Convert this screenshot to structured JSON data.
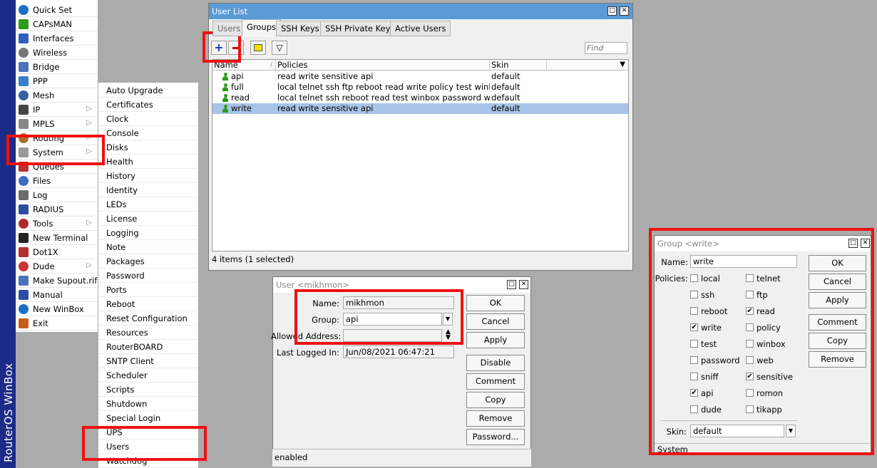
{
  "brand": "RouterOS WinBox",
  "main_menu": [
    {
      "label": "Quick Set",
      "icon": "quickset-icon",
      "arrow": false
    },
    {
      "label": "CAPsMAN",
      "icon": "capsman-icon",
      "arrow": false
    },
    {
      "label": "Interfaces",
      "icon": "interfaces-icon",
      "arrow": false
    },
    {
      "label": "Wireless",
      "icon": "wireless-icon",
      "arrow": false
    },
    {
      "label": "Bridge",
      "icon": "bridge-icon",
      "arrow": false
    },
    {
      "label": "PPP",
      "icon": "ppp-icon",
      "arrow": false
    },
    {
      "label": "Mesh",
      "icon": "mesh-icon",
      "arrow": false
    },
    {
      "label": "IP",
      "icon": "ip-icon",
      "arrow": true
    },
    {
      "label": "MPLS",
      "icon": "mpls-icon",
      "arrow": true
    },
    {
      "label": "Routing",
      "icon": "routing-icon",
      "arrow": true
    },
    {
      "label": "System",
      "icon": "system-gear-icon",
      "arrow": true
    },
    {
      "label": "Queues",
      "icon": "queues-icon",
      "arrow": false
    },
    {
      "label": "Files",
      "icon": "files-icon",
      "arrow": false
    },
    {
      "label": "Log",
      "icon": "log-icon",
      "arrow": false
    },
    {
      "label": "RADIUS",
      "icon": "radius-icon",
      "arrow": false
    },
    {
      "label": "Tools",
      "icon": "tools-icon",
      "arrow": true
    },
    {
      "label": "New Terminal",
      "icon": "terminal-icon",
      "arrow": false
    },
    {
      "label": "Dot1X",
      "icon": "dot1x-icon",
      "arrow": false
    },
    {
      "label": "Dude",
      "icon": "dude-icon",
      "arrow": true
    },
    {
      "label": "Make Supout.rif",
      "icon": "supout-icon",
      "arrow": false
    },
    {
      "label": "Manual",
      "icon": "manual-icon",
      "arrow": false
    },
    {
      "label": "New WinBox",
      "icon": "winbox-icon",
      "arrow": false
    },
    {
      "label": "Exit",
      "icon": "exit-icon",
      "arrow": false
    }
  ],
  "system_submenu": [
    "Auto Upgrade",
    "Certificates",
    "Clock",
    "Console",
    "Disks",
    "Health",
    "History",
    "Identity",
    "LEDs",
    "License",
    "Logging",
    "Note",
    "Packages",
    "Password",
    "Ports",
    "Reboot",
    "Reset Configuration",
    "Resources",
    "RouterBOARD",
    "SNTP Client",
    "Scheduler",
    "Scripts",
    "Shutdown",
    "Special Login",
    "UPS",
    "Users",
    "Watchdog"
  ],
  "user_list": {
    "title": "User List",
    "tabs": [
      "Users",
      "Groups",
      "SSH Keys",
      "SSH Private Keys",
      "Active Users"
    ],
    "active_tab": "Groups",
    "find_placeholder": "Find",
    "columns": [
      "Name",
      "Policies",
      "Skin"
    ],
    "rows": [
      {
        "name": "api",
        "policies": "read write sensitive api",
        "skin": "default",
        "selected": false
      },
      {
        "name": "full",
        "policies": "local telnet ssh ftp reboot read write policy test winbox passw...",
        "skin": "default",
        "selected": false
      },
      {
        "name": "read",
        "policies": "local telnet ssh reboot read test winbox password web sniff s...",
        "skin": "default",
        "selected": false
      },
      {
        "name": "write",
        "policies": "read write sensitive api",
        "skin": "default",
        "selected": true
      }
    ],
    "status": "4 items (1 selected)"
  },
  "user_dialog": {
    "title": "User <mikhmon>",
    "name_label": "Name:",
    "name_value": "mikhmon",
    "group_label": "Group:",
    "group_value": "api",
    "allowed_label": "Allowed Address:",
    "allowed_value": "",
    "last_label": "Last Logged In:",
    "last_value": "Jun/08/2021 06:47:21",
    "buttons": [
      "OK",
      "Cancel",
      "Apply",
      "Disable",
      "Comment",
      "Copy",
      "Remove",
      "Password..."
    ],
    "status": "enabled"
  },
  "group_dialog": {
    "title": "Group <write>",
    "name_label": "Name:",
    "name_value": "write",
    "policies_label": "Policies:",
    "policies": [
      {
        "label": "local",
        "checked": false
      },
      {
        "label": "telnet",
        "checked": false
      },
      {
        "label": "ssh",
        "checked": false
      },
      {
        "label": "ftp",
        "checked": false
      },
      {
        "label": "reboot",
        "checked": false
      },
      {
        "label": "read",
        "checked": true
      },
      {
        "label": "write",
        "checked": true
      },
      {
        "label": "policy",
        "checked": false
      },
      {
        "label": "test",
        "checked": false
      },
      {
        "label": "winbox",
        "checked": false
      },
      {
        "label": "password",
        "checked": false
      },
      {
        "label": "web",
        "checked": false
      },
      {
        "label": "sniff",
        "checked": false
      },
      {
        "label": "sensitive",
        "checked": true
      },
      {
        "label": "api",
        "checked": true
      },
      {
        "label": "romon",
        "checked": false
      },
      {
        "label": "dude",
        "checked": false
      },
      {
        "label": "tikapp",
        "checked": false
      }
    ],
    "skin_label": "Skin:",
    "skin_value": "default",
    "buttons": [
      "OK",
      "Cancel",
      "Apply",
      "Comment",
      "Copy",
      "Remove"
    ],
    "status": "System"
  },
  "colors": {
    "brand": "#1c2b87",
    "highlight": "#e11111",
    "selection": "#a8c4e7",
    "titlebar_active": "#5b9bd5"
  }
}
